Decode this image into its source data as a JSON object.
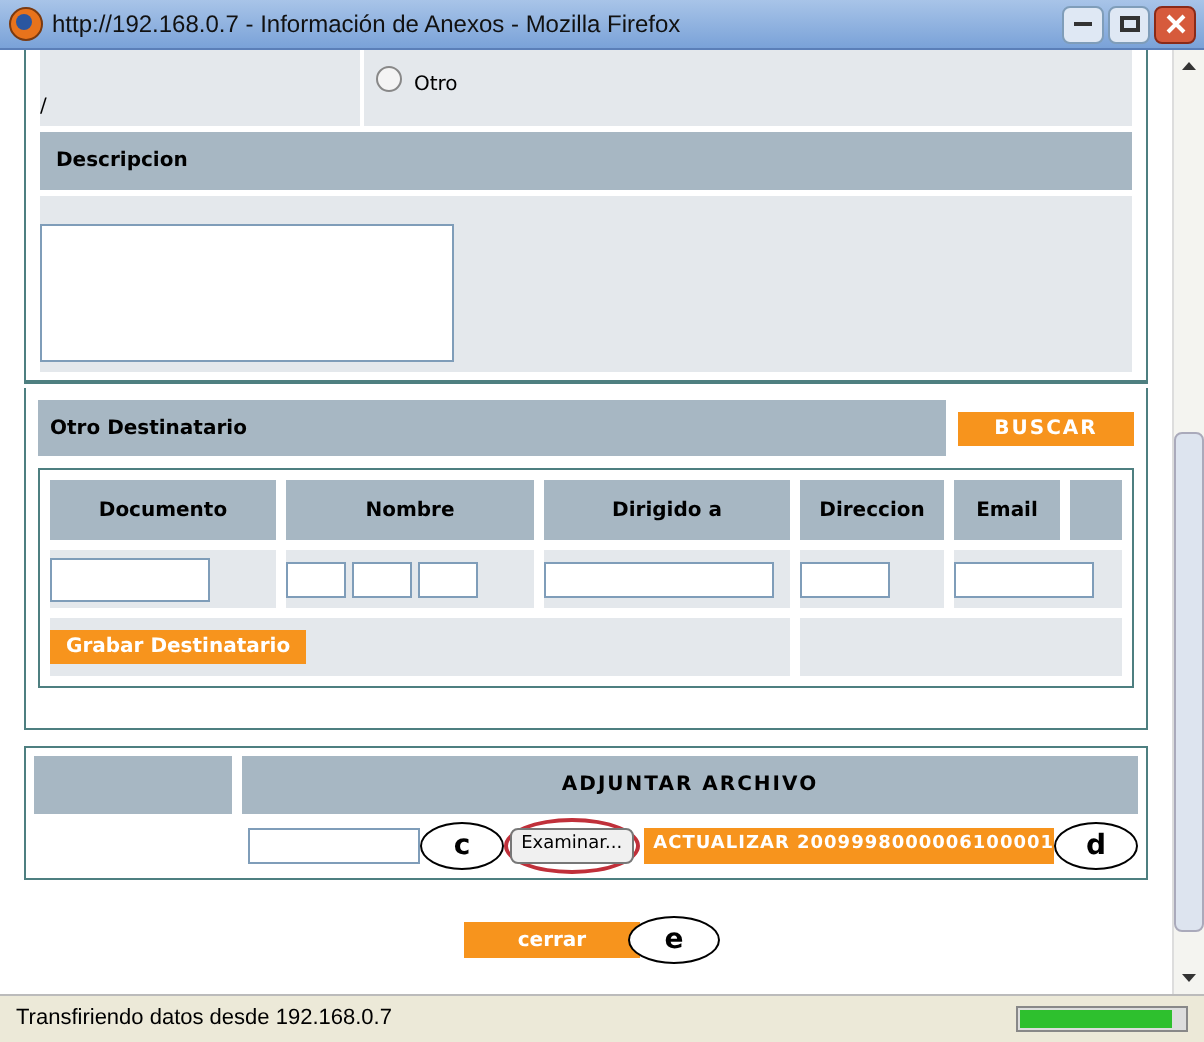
{
  "window": {
    "title": "http://192.168.0.7 - Información de Anexos - Mozilla Firefox"
  },
  "top_row": {
    "left_text": "/",
    "radio": {
      "label": "Otro",
      "selected": false
    }
  },
  "descripcion": {
    "label": "Descripcion"
  },
  "destinatario": {
    "title": "Otro Destinatario",
    "search_button": "BUSCAR",
    "columns": [
      "Documento",
      "Nombre",
      "Dirigido a",
      "Direccion",
      "Email"
    ],
    "save_button": "Grabar Destinatario"
  },
  "adjuntar": {
    "title": "ADJUNTAR ARCHIVO",
    "browse_button": "Examinar...",
    "update_button": "ACTUALIZAR 2009998000006100001",
    "markers": [
      "c",
      "d"
    ]
  },
  "close_button": {
    "label": "cerrar",
    "marker": "e"
  },
  "status_bar": {
    "text": "Transfiriendo datos desde 192.168.0.7",
    "progress": {
      "level": 0.93
    }
  }
}
